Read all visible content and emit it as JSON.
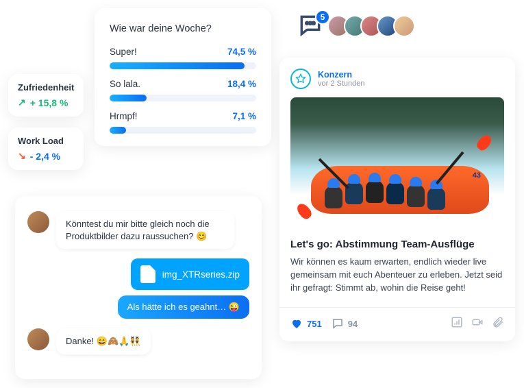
{
  "kpi": {
    "satisfaction": {
      "label": "Zufriedenheit",
      "value": "+ 15,8 %"
    },
    "workload": {
      "label": "Work Load",
      "value": "- 2,4 %"
    }
  },
  "poll": {
    "title": "Wie war deine Woche?",
    "options": [
      {
        "label": "Super!",
        "pct": "74,5 %",
        "width": 92
      },
      {
        "label": "So lala.",
        "pct": "18,4 %",
        "width": 25
      },
      {
        "label": "Hrmpf!",
        "pct": "7,1 %",
        "width": 11
      }
    ]
  },
  "chat": {
    "msg1": "Könntest du mir bitte gleich noch die Produktbilder dazu raussuchen? 😊",
    "file": "img_XTRseries.zip",
    "msg2": "Als hätte ich es geahnt… 😜",
    "msg3": "Danke! 😄🙈🙏👯"
  },
  "reactions": {
    "badge": "5"
  },
  "post": {
    "author": "Konzern",
    "time": "vor 2 Stunden",
    "raft_num": "43",
    "title": "Let's go: Abstimmung Team-Ausflüge",
    "body": "Wir können es kaum erwarten, endlich wieder live gemeinsam mit euch Abenteuer zu erleben. Jetzt seid ihr gefragt: Stimmt ab, wohin die Reise geht!",
    "likes": "751",
    "comments": "94"
  }
}
